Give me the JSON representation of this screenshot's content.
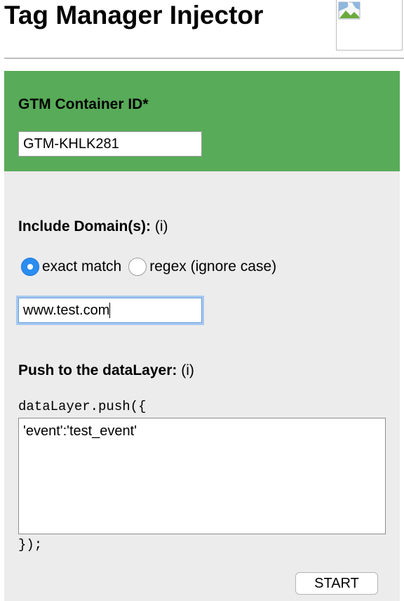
{
  "header": {
    "title": "Tag Manager Injector",
    "logo_icon": "broken-image-icon"
  },
  "gtm": {
    "label": "GTM Container ID*",
    "value": "GTM-KHLK281"
  },
  "domains": {
    "label": "Include Domain(s):",
    "hint": "(i)",
    "options": [
      {
        "label": "exact match",
        "checked": true
      },
      {
        "label": "regex (ignore case)",
        "checked": false
      }
    ],
    "value": "www.test.com"
  },
  "datalayer": {
    "label": "Push to the dataLayer:",
    "hint": "(i)",
    "prefix": "dataLayer.push({",
    "content": "'event':'test_event'",
    "suffix": "});"
  },
  "actions": {
    "start_label": "START"
  },
  "colors": {
    "green_panel": "#58ab58",
    "gray_panel": "#ececec",
    "radio_selected": "#2b8df0",
    "focus_ring": "#a6c8f0"
  }
}
